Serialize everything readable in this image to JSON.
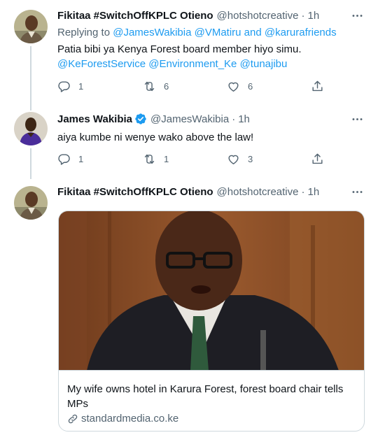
{
  "tweets": [
    {
      "name": "Fikitaa #SwitchOffKPLC Otieno",
      "handle": "@hotshotcreative",
      "separator": "·",
      "time": "1h",
      "replying_prefix": "Replying to",
      "replying_to": "@JamesWakibia @VMatiru and @karurafriends",
      "text": "Patia bibi ya Kenya Forest board member hiyo simu.",
      "mentions": [
        "@KeForestService",
        "@Environment_Ke",
        "@tunajibu"
      ],
      "stats": {
        "replies": "1",
        "retweets": "6",
        "likes": "6"
      }
    },
    {
      "name": "James Wakibia",
      "handle": "@JamesWakibia",
      "separator": "·",
      "time": "1h",
      "verified": true,
      "text": "aiya kumbe ni wenye wako above the law!",
      "stats": {
        "replies": "1",
        "retweets": "1",
        "likes": "3"
      }
    },
    {
      "name": "Fikitaa #SwitchOffKPLC Otieno",
      "handle": "@hotshotcreative",
      "separator": "·",
      "time": "1h",
      "card": {
        "title": "My wife owns hotel in Karura Forest, forest board chair tells MPs",
        "domain": "standardmedia.co.ke"
      }
    }
  ],
  "colors": {
    "accent": "#1d9bf0",
    "muted": "#536471",
    "border": "#cfd9de",
    "text": "#0f1419"
  },
  "icons": [
    "reply-icon",
    "retweet-icon",
    "like-icon",
    "share-icon",
    "more-icon",
    "verified-icon",
    "link-icon"
  ]
}
